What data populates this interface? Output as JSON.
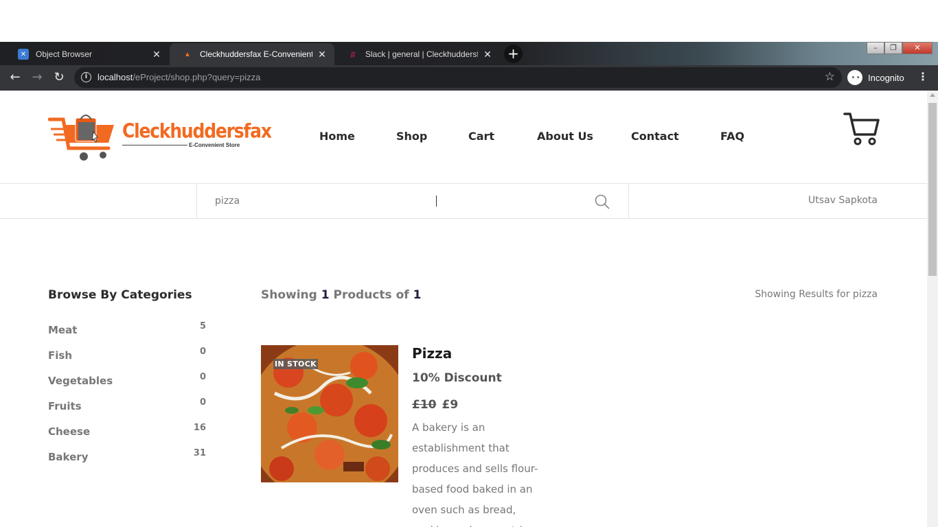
{
  "browser": {
    "tabs": [
      {
        "label": "Object Browser",
        "icon": "object-browser-icon"
      },
      {
        "label": "Cleckhuddersfax E-Convenient St",
        "icon": "xampp-icon"
      },
      {
        "label": "Slack | general | Cleckhuddersfax",
        "icon": "slack-icon"
      }
    ],
    "new_tab": "+",
    "url_host": "localhost",
    "url_path": "/eProject/shop.php?query=pizza",
    "profile_label": "Incognito"
  },
  "site": {
    "brand": "Cleckhuddersfax",
    "tagline": "E-Convenient Store",
    "nav": [
      "Home",
      "Shop",
      "Cart",
      "About Us",
      "Contact",
      "FAQ"
    ],
    "accent_color": "#f26a21"
  },
  "search": {
    "value": "pizza",
    "user": "Utsav Sapkota"
  },
  "categories": {
    "heading": "Browse By Categories",
    "items": [
      {
        "name": "Meat",
        "count": "5"
      },
      {
        "name": "Fish",
        "count": "0"
      },
      {
        "name": "Vegetables",
        "count": "0"
      },
      {
        "name": "Fruits",
        "count": "0"
      },
      {
        "name": "Cheese",
        "count": "16"
      },
      {
        "name": "Bakery",
        "count": "31"
      }
    ]
  },
  "listing": {
    "showing_prefix": "Showing",
    "showing_count": "1",
    "showing_mid": "Products of",
    "showing_total": "1",
    "results_label": "Showing Results for pizza"
  },
  "product": {
    "badge": "IN STOCK",
    "name": "Pizza",
    "discount": "10% Discount",
    "old_price": "£10",
    "price": "£9",
    "description": "A bakery is an establishment that produces and sells flour-based food baked in an oven such as bread, cookies, cakes, pastries"
  }
}
